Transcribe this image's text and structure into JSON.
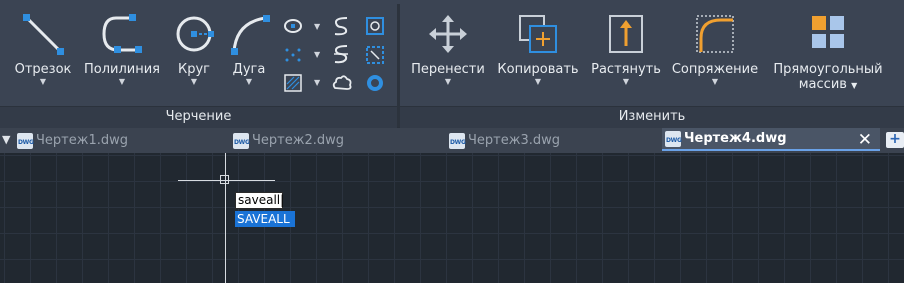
{
  "ribbon": {
    "draw_panel": {
      "title": "Черчение",
      "tools": [
        {
          "label": "Отрезок",
          "icon": "line-icon"
        },
        {
          "label": "Полилиния",
          "icon": "polyline-icon"
        },
        {
          "label": "Круг",
          "icon": "circle-icon"
        },
        {
          "label": "Дуга",
          "icon": "arc-icon"
        }
      ]
    },
    "modify_panel": {
      "title": "Изменить",
      "tools": [
        {
          "label": "Перенести",
          "icon": "move-icon"
        },
        {
          "label": "Копировать",
          "icon": "copy-icon"
        },
        {
          "label": "Растянуть",
          "icon": "stretch-icon"
        },
        {
          "label": "Сопряжение",
          "icon": "fillet-icon"
        },
        {
          "label_line1": "Прямоугольный",
          "label_line2": "массив",
          "icon": "rectangular-array-icon"
        }
      ]
    }
  },
  "tabs": [
    {
      "label": "Чертеж1.dwg",
      "active": false
    },
    {
      "label": "Чертеж2.dwg",
      "active": false
    },
    {
      "label": "Чертеж3.dwg",
      "active": false
    },
    {
      "label": "Чертеж4.dwg",
      "active": true
    }
  ],
  "tab_icon_text": "DWG",
  "close_glyph": "✕",
  "new_tab_glyph": "+",
  "command": {
    "input_value": "saveall",
    "suggestion": "SAVEALL"
  },
  "colors": {
    "accent": "#1a73d6",
    "grip_blue": "#2f8fe0",
    "array_orange": "#f0a030",
    "array_blue": "#a9c6ea"
  }
}
